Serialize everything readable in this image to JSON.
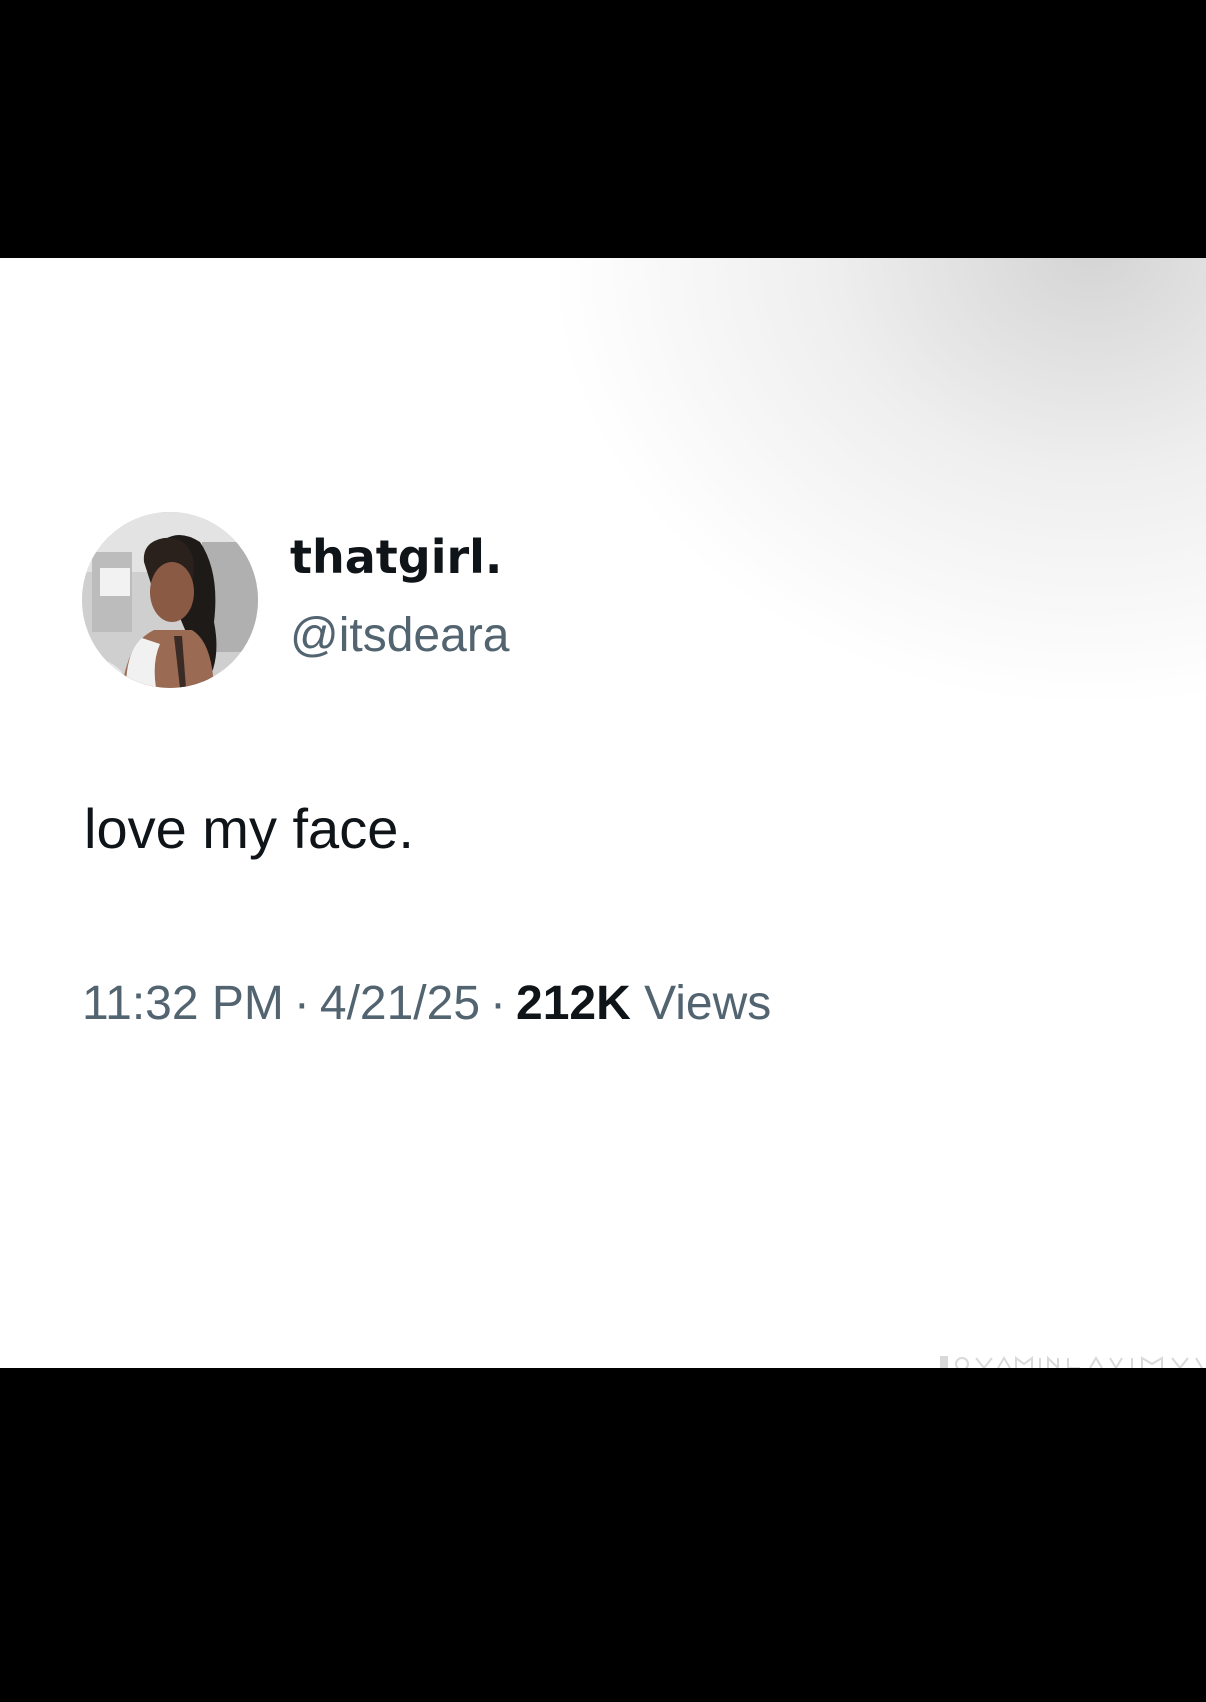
{
  "tweet": {
    "display_name": "thatgirl.",
    "handle": "@itsdeara",
    "text": "love my face.",
    "time": "11:32 PM",
    "date": "4/21/25",
    "separator": "·",
    "views_count": "212K",
    "views_label": "Views"
  },
  "colors": {
    "text_primary": "#0f1419",
    "text_secondary": "#536471",
    "letterbox": "#000000",
    "card_background": "#ffffff"
  },
  "avatar": {
    "icon": "profile-photo"
  }
}
